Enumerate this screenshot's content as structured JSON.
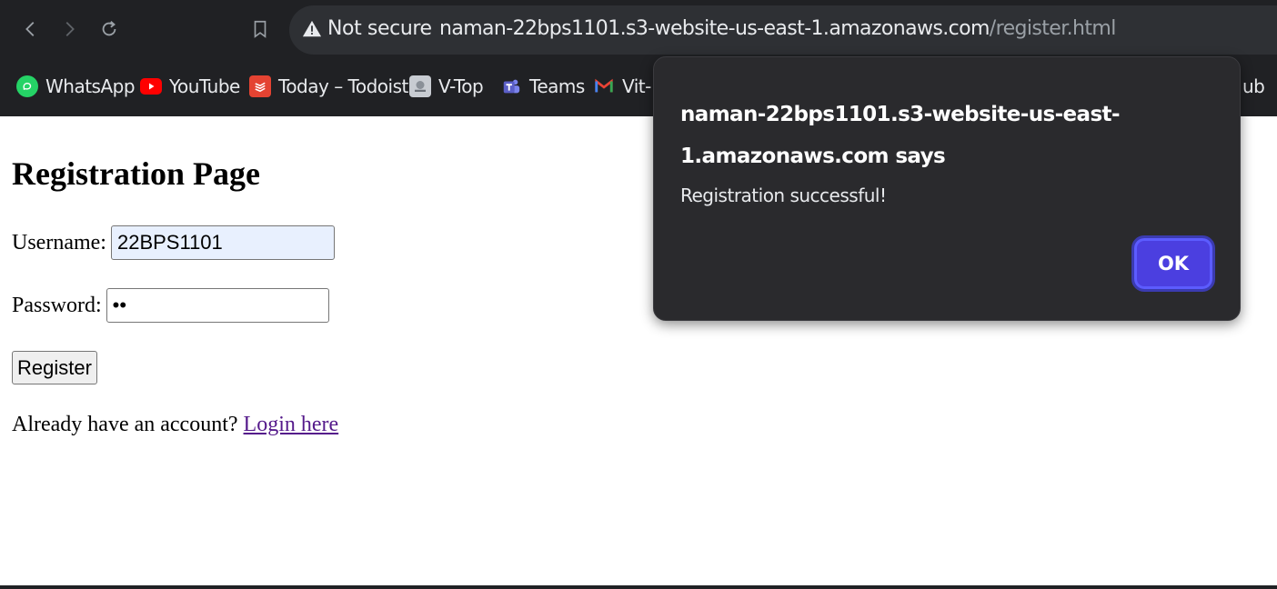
{
  "browser": {
    "security_label": "Not secure",
    "url_host": "naman-22bps1101.s3-website-us-east-1.amazonaws.com",
    "url_path": "/register.html",
    "bookmarks": [
      {
        "label": "WhatsApp",
        "icon": "whatsapp-icon",
        "color": "#25d366"
      },
      {
        "label": "YouTube",
        "icon": "youtube-icon",
        "color": "#ff0000"
      },
      {
        "label": "Today – Todoist",
        "icon": "todoist-icon",
        "color": "#e44332"
      },
      {
        "label": "V-Top",
        "icon": "vtop-icon",
        "color": "#c8ccd2"
      },
      {
        "label": "Teams",
        "icon": "teams-icon",
        "color": "#5b5fc7"
      },
      {
        "label": "Vit-",
        "icon": "gmail-icon",
        "color": "#ea4335"
      },
      {
        "label": "ub",
        "icon": "github-icon",
        "color": "#e8eaed"
      }
    ]
  },
  "page": {
    "title": "Registration Page",
    "username_label": "Username:",
    "username_value": "22BPS1101",
    "password_label": "Password:",
    "password_value": "••",
    "register_label": "Register",
    "login_prompt": "Already have an account?",
    "login_link": "Login here"
  },
  "dialog": {
    "title": "naman-22bps1101.s3-website-us-east-1.amazonaws.com says",
    "message": "Registration successful!",
    "ok_label": "OK",
    "accent_color": "#4b3fe0"
  }
}
